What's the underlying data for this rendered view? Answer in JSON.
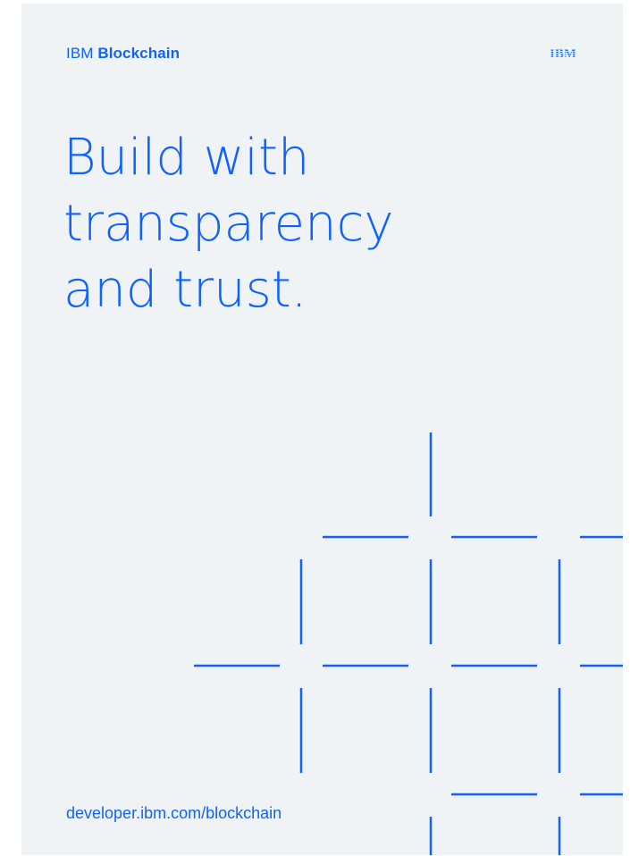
{
  "header": {
    "brand_company": "IBM",
    "brand_product": "Blockchain",
    "logo_icon": "ibm-striped-logo-icon",
    "logo_text": "IBM"
  },
  "headline": {
    "lines": [
      "Build with",
      "transparency",
      "and trust."
    ]
  },
  "footer": {
    "url": "developer.ibm.com/blockchain"
  },
  "colors": {
    "accent": "#0f62fe",
    "background": "#f0f3f6"
  },
  "decoration": {
    "icon": "grid-pattern-icon"
  }
}
